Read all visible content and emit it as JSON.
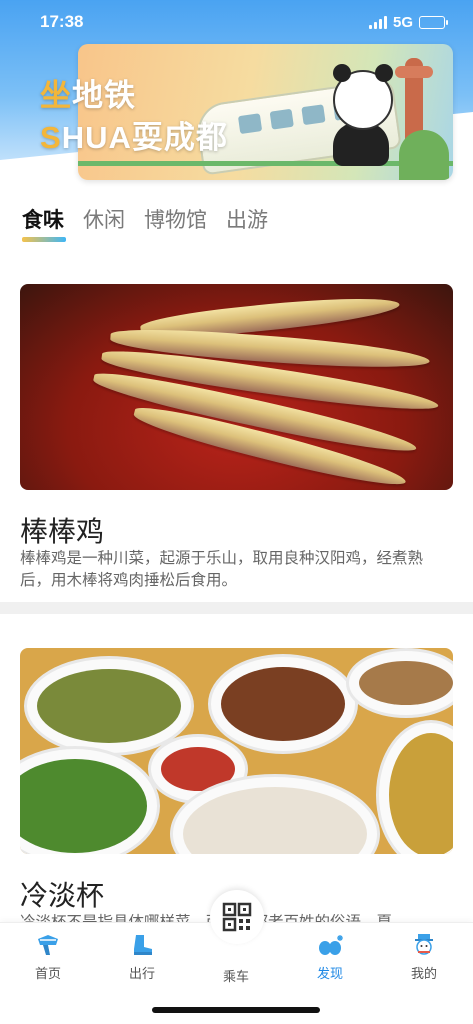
{
  "status_bar": {
    "time": "17:38",
    "network": "5G",
    "battery_level": 0.3
  },
  "header": {
    "title_line1_highlight": "坐",
    "title_line1_rest": "地铁",
    "title_line2_highlight": "S",
    "title_line2_rest": "HUA耍成都"
  },
  "tabs": [
    {
      "label": "食味",
      "active": true
    },
    {
      "label": "休闲",
      "active": false
    },
    {
      "label": "博物馆",
      "active": false
    },
    {
      "label": "出游",
      "active": false
    }
  ],
  "articles": [
    {
      "title": "棒棒鸡",
      "description": "棒棒鸡是一种川菜，起源于乐山，取用良种汉阳鸡，经煮熟后，用木棒将鸡肉捶松后食用。"
    },
    {
      "title": "冷淡杯",
      "description": "冷淡杯不是指具体哪样菜，而是成都老百姓的俗语，夏"
    }
  ],
  "bottom_nav": {
    "items": [
      {
        "label": "首页",
        "icon": "home-scarf-icon"
      },
      {
        "label": "出行",
        "icon": "boot-icon"
      },
      {
        "label": "乘车",
        "icon": "qr-code-icon"
      },
      {
        "label": "发现",
        "icon": "snowflake-mittens-icon",
        "active": true
      },
      {
        "label": "我的",
        "icon": "snowman-icon"
      }
    ]
  },
  "colors": {
    "accent": "#1e88e5",
    "header_blue": "#4aa3f2",
    "highlight": "#f3b63a"
  }
}
